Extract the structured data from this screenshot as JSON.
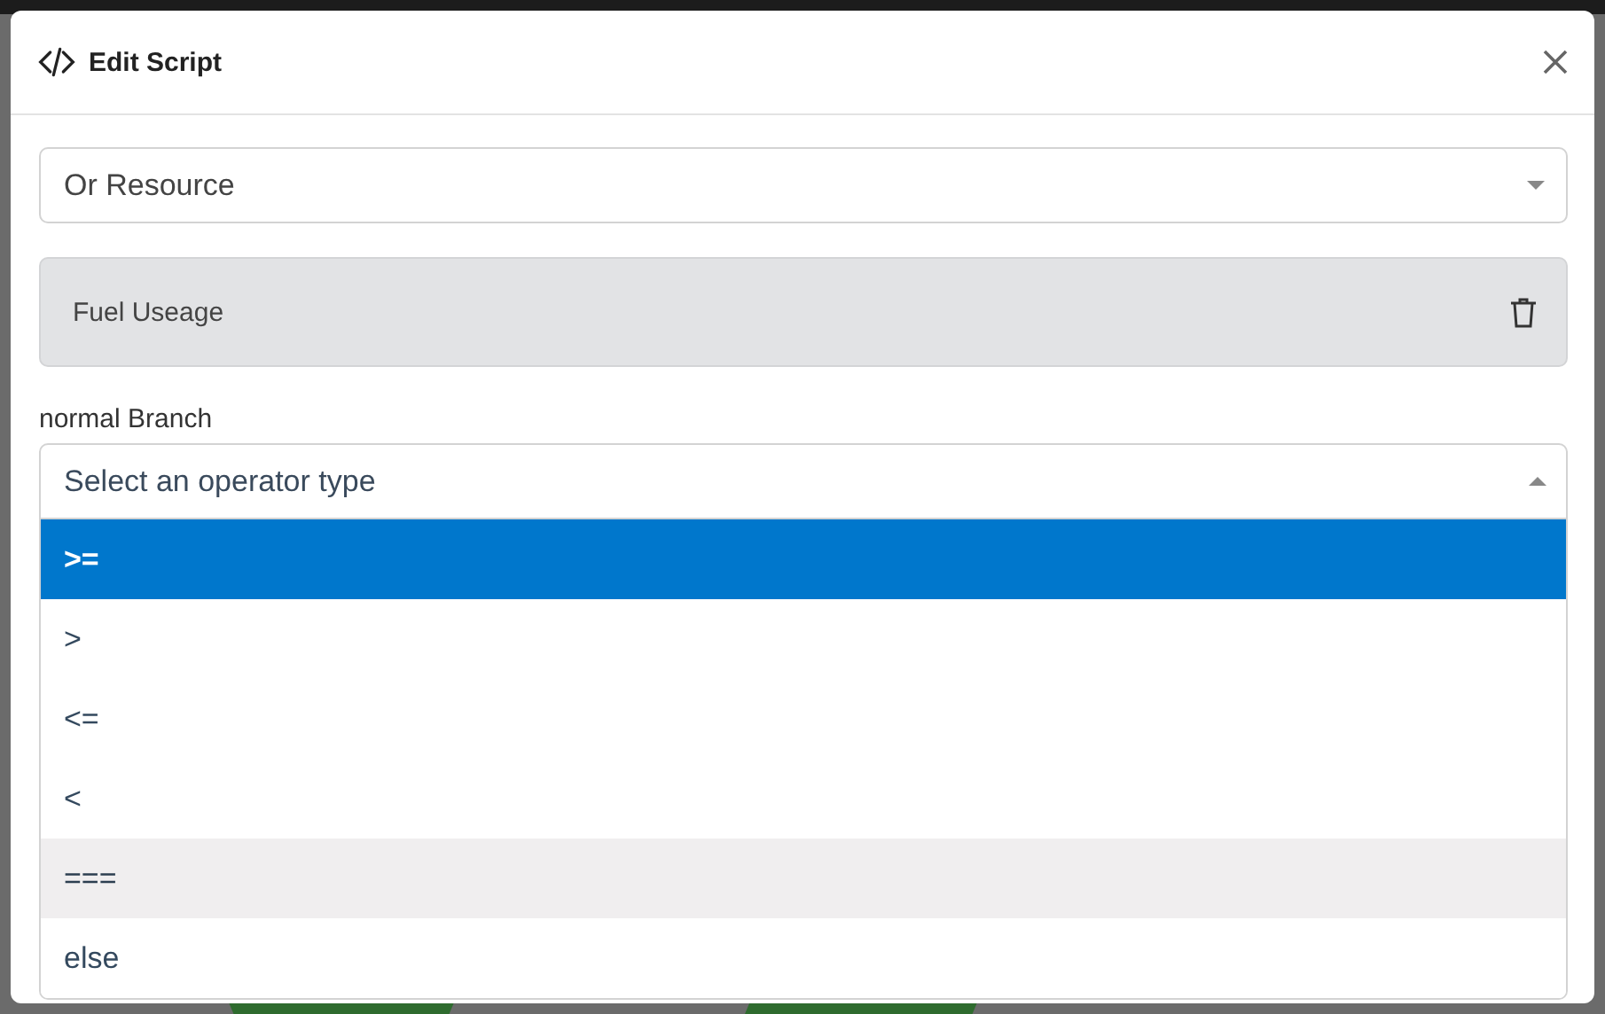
{
  "modal": {
    "title": "Edit Script"
  },
  "resource_select": {
    "value": "Or Resource"
  },
  "resource_card": {
    "label": "Fuel Useage"
  },
  "branch": {
    "label": "normal Branch",
    "placeholder": "Select an operator type",
    "expanded": true,
    "options": [
      {
        "label": ">=",
        "selected": true,
        "hovered": false
      },
      {
        "label": ">",
        "selected": false,
        "hovered": false
      },
      {
        "label": "<=",
        "selected": false,
        "hovered": false
      },
      {
        "label": "<",
        "selected": false,
        "hovered": false
      },
      {
        "label": "===",
        "selected": false,
        "hovered": true
      },
      {
        "label": "else",
        "selected": false,
        "hovered": false
      }
    ]
  }
}
